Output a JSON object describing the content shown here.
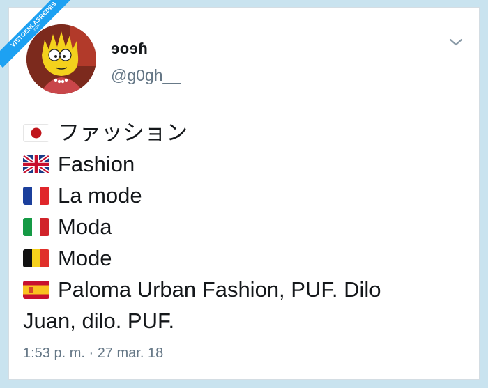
{
  "watermark": {
    "text": "VISTOENLASREDES",
    "sub": ".com"
  },
  "user": {
    "display_name": "ɘoɘɦ",
    "handle": "@g0gh__"
  },
  "menu_icon": "chevron-down-icon",
  "tweet": {
    "lines": [
      {
        "flag": "japan-flag-icon",
        "text": "ファッション"
      },
      {
        "flag": "uk-flag-icon",
        "text": "Fashion"
      },
      {
        "flag": "france-flag-icon",
        "text": "La mode"
      },
      {
        "flag": "italy-flag-icon",
        "text": "Moda"
      },
      {
        "flag": "belgium-flag-icon",
        "text": "Mode"
      },
      {
        "flag": "spain-flag-icon",
        "text": "Paloma Urban Fashion, PUF. Dilo"
      }
    ],
    "continuation": "Juan, dilo. PUF."
  },
  "timestamp": "1:53 p. m. · 27 mar. 18",
  "colors": {
    "text": "#14171a",
    "muted": "#657786",
    "accent": "#1da1f2",
    "background": "#c9e3ef"
  }
}
